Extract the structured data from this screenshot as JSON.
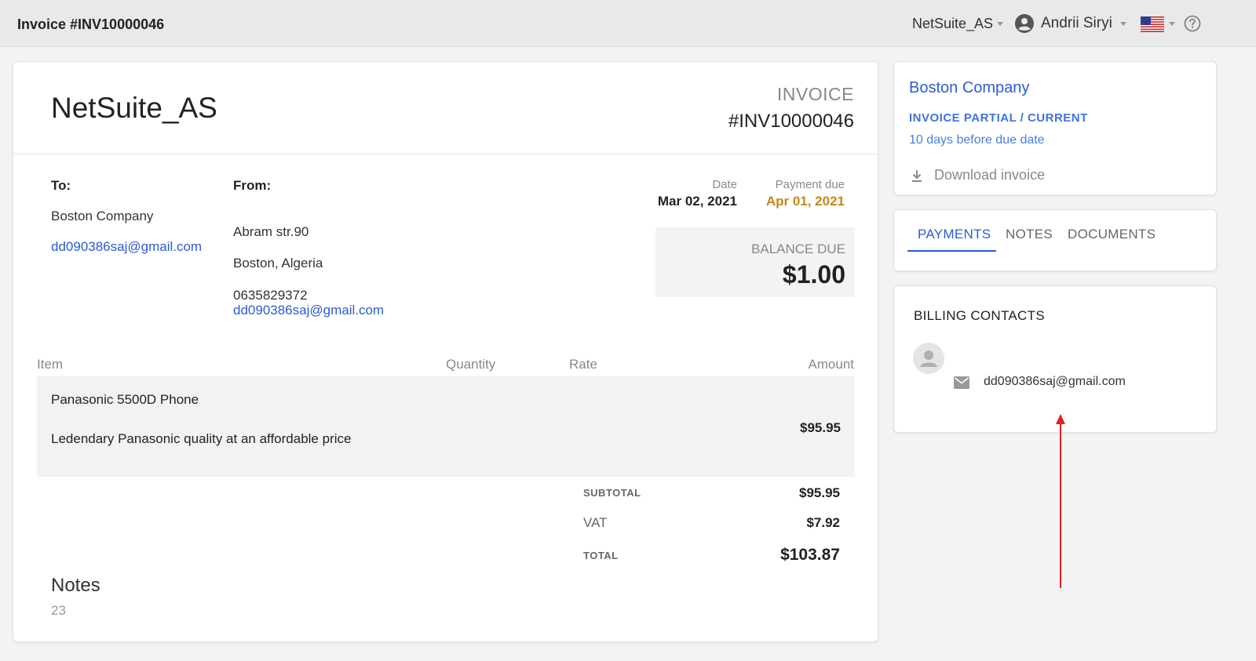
{
  "header": {
    "title": "Invoice #INV10000046",
    "company_selector": "NetSuite_AS",
    "user_name": "Andrii Siryi",
    "language_flag": "us-flag-icon",
    "help_icon": "help-circle-icon"
  },
  "invoice": {
    "company_name": "NetSuite_AS",
    "label": "INVOICE",
    "number": "#INV10000046",
    "to": {
      "label": "To:",
      "name": "Boston Company",
      "email": "dd090386saj@gmail.com"
    },
    "from": {
      "label": "From:",
      "address_line1": "Abram str.90",
      "address_line2": "Boston, Algeria",
      "phone": "0635829372",
      "email": "dd090386saj@gmail.com"
    },
    "date": {
      "label": "Date",
      "value": "Mar 02, 2021"
    },
    "payment_due": {
      "label": "Payment due",
      "value": "Apr 01, 2021"
    },
    "balance_due": {
      "label": "BALANCE DUE",
      "value": "$1.00"
    },
    "table": {
      "headers": {
        "item": "Item",
        "quantity": "Quantity",
        "rate": "Rate",
        "amount": "Amount"
      },
      "rows": [
        {
          "name": "Panasonic 5500D Phone",
          "description": "Ledendary Panasonic quality at an affordable price",
          "quantity": "",
          "rate": "",
          "amount": "$95.95"
        }
      ]
    },
    "totals": {
      "subtotal_label": "SUBTOTAL",
      "subtotal": "$95.95",
      "vat_label": "VAT",
      "vat": "$7.92",
      "total_label": "TOTAL",
      "total": "$103.87"
    },
    "notes": {
      "title": "Notes",
      "value": "23"
    }
  },
  "sidebar": {
    "summary": {
      "company": "Boston Company",
      "status": "INVOICE PARTIAL / CURRENT",
      "due_info": "10 days before due date",
      "download_label": "Download invoice"
    },
    "tabs": [
      {
        "label": "PAYMENTS",
        "active": true
      },
      {
        "label": "NOTES",
        "active": false
      },
      {
        "label": "DOCUMENTS",
        "active": false
      }
    ],
    "billing_contacts": {
      "title": "BILLING CONTACTS",
      "contacts": [
        {
          "email": "dd090386saj@gmail.com"
        }
      ]
    }
  },
  "colors": {
    "accent_blue": "#2a5bd7",
    "due_orange": "#c8861a",
    "annotation_arrow": "#e02020"
  }
}
